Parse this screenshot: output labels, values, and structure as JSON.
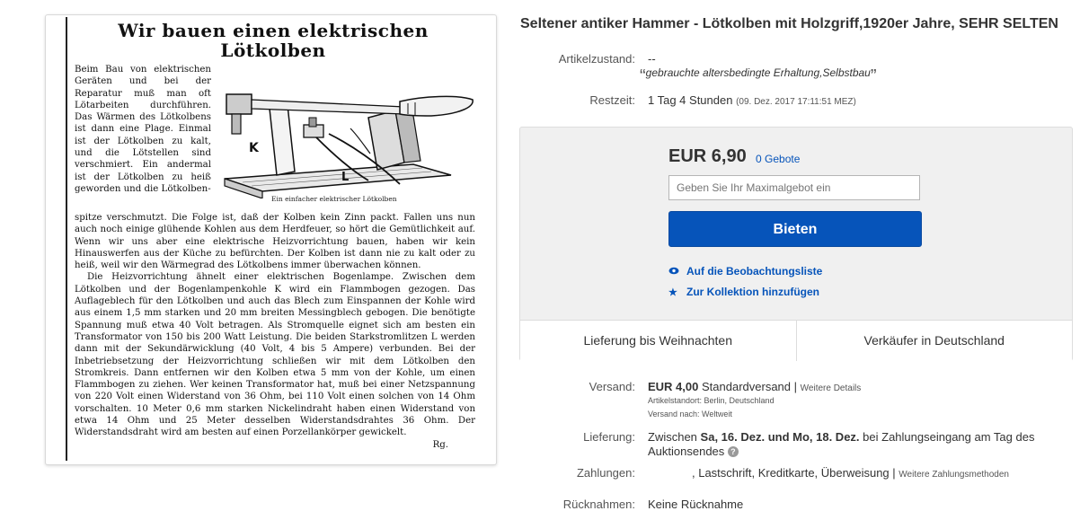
{
  "article_image": {
    "title_line1": "Wir bauen einen elektrischen",
    "title_line2": "Lötkolben",
    "col_text": "Beim Bau von elektrischen Geräten und bei der Reparatur muß man oft Lötarbeiten durchführen. Das Wärmen des Lötkolbens ist dann eine Plage. Einmal ist der Lötkolben zu kalt, und die Lötstellen sind verschmiert. Ein andermal ist der Lötkolben zu heiß geworden und die Lötkolben-",
    "caption": "Ein einfacher elektrischer Lötkolben",
    "label_k": "K",
    "label_l": "L",
    "paragraph1": "spitze verschmutzt. Die Folge ist, daß der Kolben kein Zinn packt. Fallen uns nun auch noch einige glühende Kohlen aus dem Herdfeuer, so hört die Gemütlichkeit auf. Wenn wir uns aber eine elektrische Heizvorrichtung bauen, haben wir kein Hinauswerfen aus der Küche zu befürchten. Der Kolben ist dann nie zu kalt oder zu heiß, weil wir den Wärmegrad des Lötkolbens immer überwachen können.",
    "paragraph2": "Die Heizvorrichtung ähnelt einer elektrischen Bogenlampe. Zwischen dem Lötkolben und der Bogenlampenkohle K wird ein Flammbogen gezogen. Das Auflageblech für den Lötkolben und auch das Blech zum Einspannen der Kohle wird aus einem 1,5 mm starken und 20 mm breiten Messingblech gebogen. Die benötigte Spannung muß etwa 40 Volt betragen. Als Stromquelle eignet sich am besten ein Transformator von 150 bis 200 Watt Leistung. Die beiden Starkstromlitzen L werden dann mit der Sekundärwicklung (40 Volt, 4 bis 5 Ampere) verbunden. Bei der Inbetriebsetzung der Heizvorrichtung schließen wir mit dem Lötkolben den Stromkreis. Dann entfernen wir den Kolben etwa 5 mm von der Kohle, um einen Flammbogen zu ziehen. Wer keinen Transformator hat, muß bei einer Netzspannung von 220 Volt einen Widerstand von 36 Ohm, bei 110 Volt einen solchen von 14 Ohm vorschalten. 10 Meter 0,6 mm starken Nickelindraht haben einen Widerstand von etwa 14 Ohm und 25 Meter desselben Widerstandsdrahtes 36 Ohm. Der Widerstandsdraht wird am besten auf einen Porzellankörper gewickelt.",
    "signature": "Rg."
  },
  "listing": {
    "title": "Seltener antiker Hammer - Lötkolben mit Holzgriff,1920er Jahre, SEHR SELTEN",
    "condition_label": "Artikelzustand:",
    "condition_value": "--",
    "condition_quote": "gebrauchte altersbedingte Erhaltung,Selbstbau",
    "quote_open": "“",
    "quote_close": "”",
    "time_label": "Restzeit:",
    "time_value": "1 Tag 4 Stunden",
    "time_end": "(09. Dez. 2017   17:11:51 MEZ)"
  },
  "bid": {
    "price": "EUR 6,90",
    "bids_count": "0 Gebote",
    "input_placeholder": "Geben Sie Ihr Maximalgebot ein",
    "button": "Bieten",
    "watch": "Auf die Beobachtungsliste",
    "collection": "Zur Kollektion hinzufügen",
    "tile_left": "Lieferung bis Weihnachten",
    "tile_right": "Verkäufer in Deutschland"
  },
  "shipping": {
    "label": "Versand:",
    "price": "EUR 4,00",
    "method": "Standardversand",
    "sep": "|",
    "more": "Weitere Details",
    "location": "Artikelstandort: Berlin, Deutschland",
    "to": "Versand nach: Weltweit"
  },
  "delivery": {
    "label": "Lieferung:",
    "prefix": "Zwischen",
    "dates": "Sa, 16. Dez. und Mo, 18. Dez.",
    "suffix": "bei Zahlungseingang am Tag des",
    "line2": "Auktionsendes",
    "help": "?"
  },
  "payments": {
    "label": "Zahlungen:",
    "methods": ",  Lastschrift,  Kreditkarte,  Überweisung",
    "sep": "|",
    "more": "Weitere Zahlungsmethoden"
  },
  "returns": {
    "label": "Rücknahmen:",
    "value": "Keine Rücknahme"
  },
  "colors": {
    "primary_button": "#0654ba",
    "link": "#0654ba",
    "bid_panel_bg": "#f0f0f0"
  }
}
